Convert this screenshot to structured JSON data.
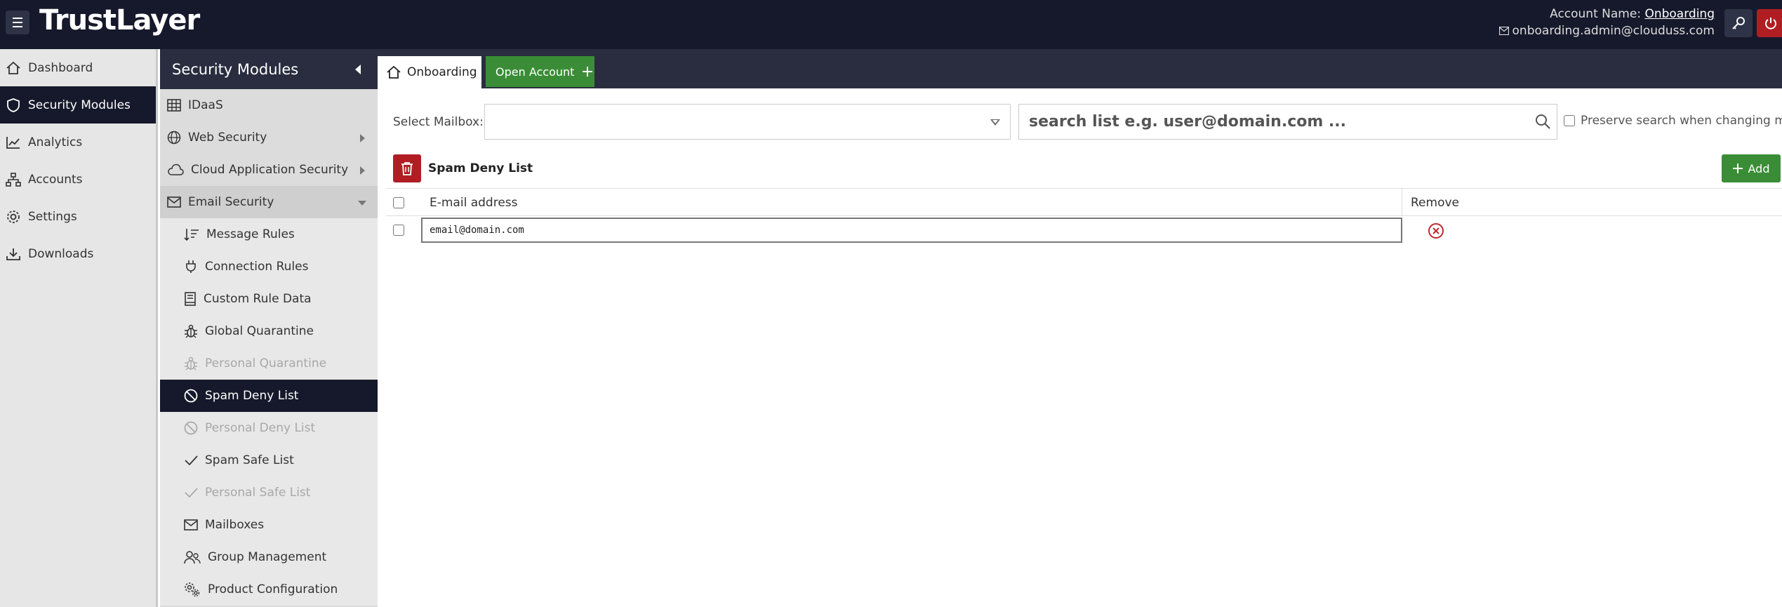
{
  "header": {
    "brand": "TrustLayer",
    "account_label": "Account Name:",
    "account_name": "Onboarding",
    "email": "onboarding.admin@clouduss.com"
  },
  "leftnav": {
    "items": [
      {
        "label": "Dashboard",
        "icon": "home-icon"
      },
      {
        "label": "Security Modules",
        "icon": "shield-icon",
        "active": true
      },
      {
        "label": "Analytics",
        "icon": "chart-icon"
      },
      {
        "label": "Accounts",
        "icon": "sitemap-icon"
      },
      {
        "label": "Settings",
        "icon": "gear-icon"
      },
      {
        "label": "Downloads",
        "icon": "download-icon"
      }
    ]
  },
  "submenu": {
    "title": "Security Modules",
    "items": [
      {
        "label": "IDaaS",
        "icon": "grid-icon"
      },
      {
        "label": "Web Security",
        "icon": "globe-icon"
      },
      {
        "label": "Cloud Application Security",
        "icon": "cloud-icon"
      },
      {
        "label": "Email Security",
        "icon": "envelope-icon"
      },
      {
        "label": "Message Rules",
        "icon": "sort-icon"
      },
      {
        "label": "Connection Rules",
        "icon": "plug-icon"
      },
      {
        "label": "Custom Rule Data",
        "icon": "book-icon"
      },
      {
        "label": "Global Quarantine",
        "icon": "bug-icon"
      },
      {
        "label": "Personal Quarantine",
        "icon": "bug-icon"
      },
      {
        "label": "Spam Deny List",
        "icon": "ban-icon"
      },
      {
        "label": "Personal Deny List",
        "icon": "ban-icon"
      },
      {
        "label": "Spam Safe List",
        "icon": "check-icon"
      },
      {
        "label": "Personal Safe List",
        "icon": "check-icon"
      },
      {
        "label": "Mailboxes",
        "icon": "envelope-icon"
      },
      {
        "label": "Group Management",
        "icon": "users-icon"
      },
      {
        "label": "Product Configuration",
        "icon": "gears-icon"
      }
    ]
  },
  "tabs": {
    "home": "Onboarding",
    "open_account": "Open Account"
  },
  "mailbox": {
    "label": "Select Mailbox:",
    "selected": ""
  },
  "search": {
    "placeholder": "search list e.g. user@domain.com ...",
    "preserve_label": "Preserve search when changing mailbo"
  },
  "list": {
    "title": "Spam Deny List",
    "add_label": "Add",
    "col_email": "E-mail address",
    "col_remove": "Remove",
    "rows": [
      {
        "email": "email@domain.com"
      }
    ]
  },
  "colors": {
    "topbar": "#16192b",
    "accent_green": "#3a8d36",
    "danger_red": "#b01e24"
  }
}
